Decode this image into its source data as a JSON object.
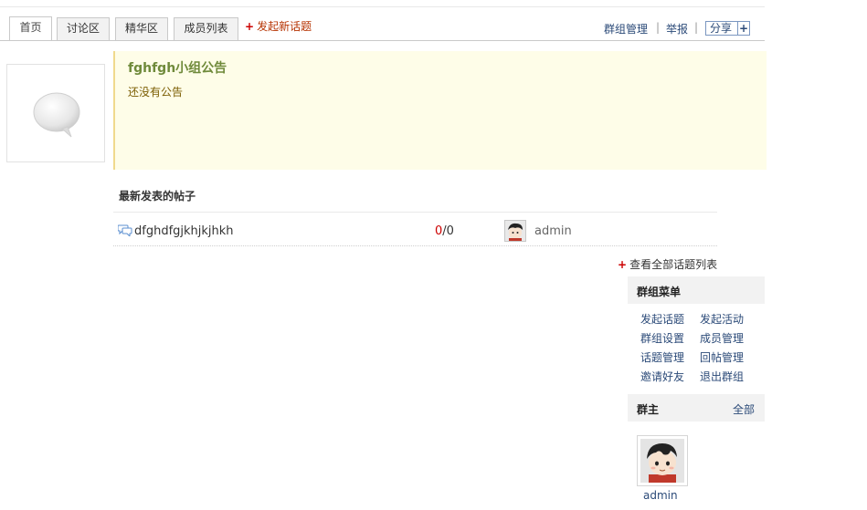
{
  "tabs": [
    {
      "label": "首页",
      "active": true
    },
    {
      "label": "讨论区",
      "active": false
    },
    {
      "label": "精华区",
      "active": false
    },
    {
      "label": "成员列表",
      "active": false
    }
  ],
  "new_topic_label": "发起新话题",
  "top_links": {
    "manage": "群组管理",
    "report": "举报",
    "share": "分享",
    "separator": "|"
  },
  "announcement": {
    "title": "fghfgh小组公告",
    "text": "还没有公告"
  },
  "latest_posts": {
    "title": "最新发表的帖子",
    "posts": [
      {
        "title": "dfghdfgjkhjkjhkh",
        "replies": "0",
        "views": "0",
        "author": "admin"
      }
    ],
    "count_separator": "/",
    "view_all": "查看全部话题列表"
  },
  "group_menu": {
    "title": "群组菜单",
    "items": [
      "发起话题",
      "发起活动",
      "群组设置",
      "成员管理",
      "话题管理",
      "回帖管理",
      "邀请好友",
      "退出群组"
    ]
  },
  "owner": {
    "title": "群主",
    "all_link": "全部",
    "name": "admin"
  },
  "colors": {
    "announcement_bg": "#fefde8",
    "announcement_title": "#6f8a3a",
    "link": "#2b4a78",
    "new_topic": "#b63200"
  }
}
